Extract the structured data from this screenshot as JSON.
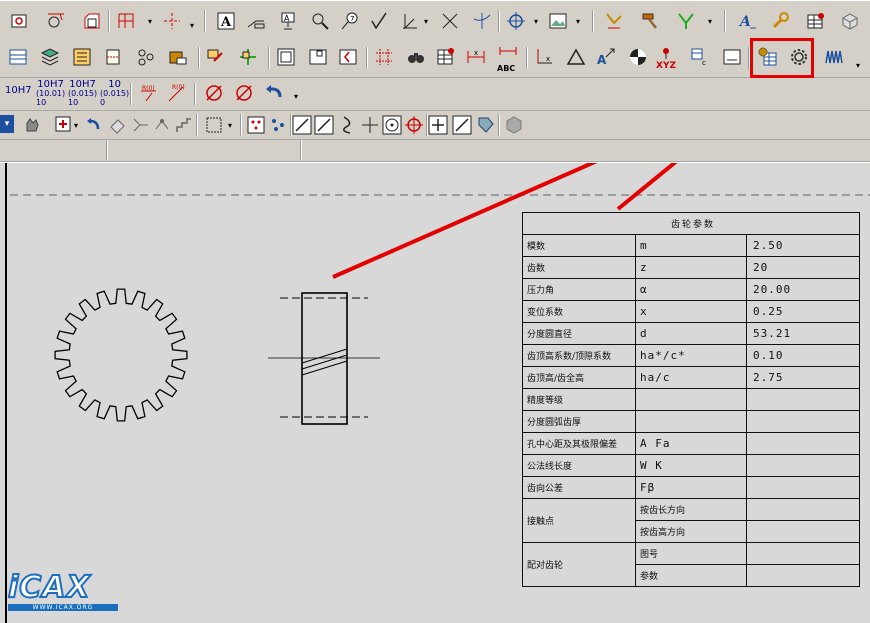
{
  "toolbar_row3": {
    "tol_10h7": "10H7",
    "tol_a_top": "10H7",
    "tol_a_mid": "(10.01)",
    "tol_a_bot": "10",
    "tol_b_top": "10H7",
    "tol_b_mid": "(0.015)",
    "tol_b_bot": "10",
    "tol_c_top": "10",
    "tol_c_mid": "(0.015)",
    "tol_c_bot": "0"
  },
  "toolbar_row2": {
    "abc_label": "ABC",
    "xyz_label": "XYZ"
  },
  "colors": {
    "toolbar_bg": "#d4d0c8",
    "canvas_bg": "#d8d8d8",
    "highlight_red": "#e30000",
    "icon_blue": "#1c4fa0"
  },
  "gear_table": {
    "title": "齿轮参数",
    "rows": [
      {
        "name": "模数",
        "symbol": "m",
        "value": "2.50"
      },
      {
        "name": "齿数",
        "symbol": "z",
        "value": "20"
      },
      {
        "name": "压力角",
        "symbol": "α",
        "value": "20.00"
      },
      {
        "name": "变位系数",
        "symbol": "x",
        "value": "0.25"
      },
      {
        "name": "分度圆直径",
        "symbol": "d",
        "value": "53.21"
      },
      {
        "name": "齿顶高系数/顶隙系数",
        "symbol": "ha*/c*",
        "value": "0.10"
      },
      {
        "name": "齿顶高/齿全高",
        "symbol": "ha/c",
        "value": "2.75"
      },
      {
        "name": "精度等级",
        "symbol": "",
        "value": ""
      },
      {
        "name": "分度圆弧齿厚",
        "symbol": "",
        "value": ""
      },
      {
        "name": "孔中心距及其极限偏差",
        "symbol": "A Fa",
        "value": ""
      },
      {
        "name": "公法线长度",
        "symbol": "W K",
        "value": ""
      },
      {
        "name": "齿向公差",
        "symbol": "Fβ",
        "value": ""
      }
    ],
    "contact": {
      "name": "接触点",
      "sub1": "按齿长方向",
      "sub2": "按齿高方向"
    },
    "mating": {
      "name": "配对齿轮",
      "sub1": "图号",
      "sub2": "参数"
    }
  },
  "logo": {
    "brand": "iCAX",
    "url": "WWW.ICAX.ORG"
  }
}
